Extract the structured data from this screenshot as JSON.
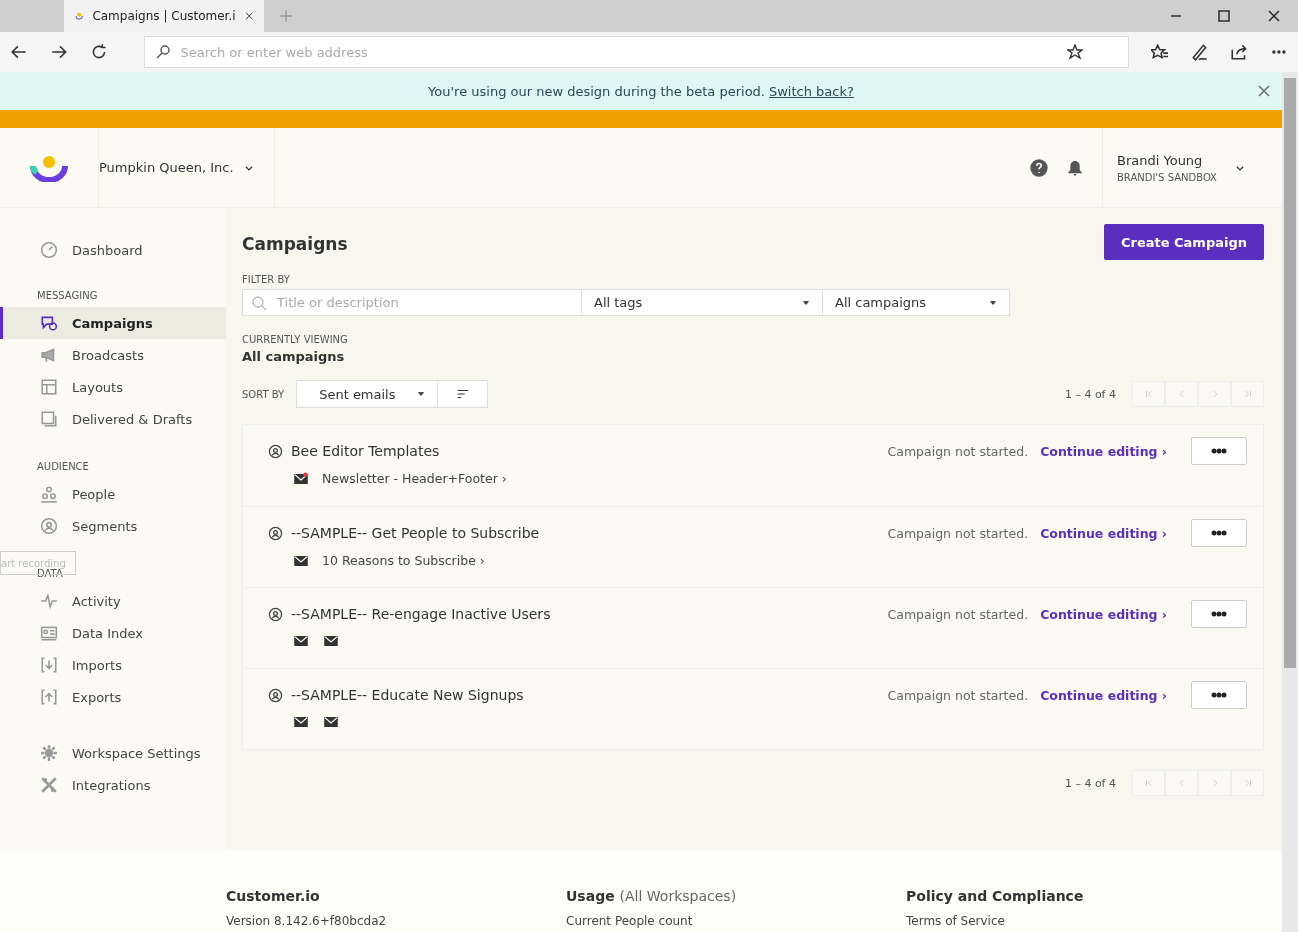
{
  "browser": {
    "tab_title": "Campaigns | Customer.i",
    "address_placeholder": "Search or enter web address"
  },
  "banner": {
    "text": "You're using our new design during the beta period.",
    "link": "Switch back?"
  },
  "header": {
    "workspace": "Pumpkin Queen, Inc.",
    "user_name": "Brandi Young",
    "sandbox": "BRANDI'S SANDBOX"
  },
  "sidebar": {
    "sections": [
      {
        "items": [
          {
            "label": "Dashboard",
            "selected": false
          }
        ]
      },
      {
        "heading": "MESSAGING",
        "items": [
          {
            "label": "Campaigns",
            "selected": true
          },
          {
            "label": "Broadcasts",
            "selected": false
          },
          {
            "label": "Layouts",
            "selected": false
          },
          {
            "label": "Delivered & Drafts",
            "selected": false
          }
        ]
      },
      {
        "heading": "AUDIENCE",
        "items": [
          {
            "label": "People",
            "selected": false
          },
          {
            "label": "Segments",
            "selected": false
          }
        ]
      },
      {
        "heading": "DATA",
        "items": [
          {
            "label": "Activity",
            "selected": false
          },
          {
            "label": "Data Index",
            "selected": false
          },
          {
            "label": "Imports",
            "selected": false
          },
          {
            "label": "Exports",
            "selected": false
          }
        ]
      },
      {
        "items": [
          {
            "label": "Workspace Settings",
            "selected": false
          },
          {
            "label": "Integrations",
            "selected": false
          }
        ]
      }
    ],
    "recording_tooltip": "art recording"
  },
  "main": {
    "title": "Campaigns",
    "create_button": "Create Campaign",
    "filter_label": "FILTER BY",
    "search_placeholder": "Title or description",
    "tags_select": "All tags",
    "campaigns_select": "All campaigns",
    "viewing_label": "CURRENTLY VIEWING",
    "viewing_value": "All campaigns",
    "sort_label": "SORT BY",
    "sort_select": "Sent emails",
    "pagination": "1 – 4 of 4",
    "pagination_bottom": "1 – 4 of 4"
  },
  "campaigns": [
    {
      "name": "Bee Editor Templates",
      "status": "Campaign not started.",
      "action": "Continue editing ›",
      "messages": [
        {
          "kind": "named",
          "label": "Newsletter - Header+Footer ›",
          "alert": true
        }
      ]
    },
    {
      "name": "--SAMPLE-- Get People to Subscribe",
      "status": "Campaign not started.",
      "action": "Continue editing ›",
      "messages": [
        {
          "kind": "named",
          "label": "10 Reasons to Subscribe ›",
          "alert": false
        }
      ]
    },
    {
      "name": "--SAMPLE-- Re-engage Inactive Users",
      "status": "Campaign not started.",
      "action": "Continue editing ›",
      "messages": [
        {
          "kind": "icon",
          "alert": false
        },
        {
          "kind": "icon",
          "alert": false
        }
      ]
    },
    {
      "name": "--SAMPLE-- Educate New Signups",
      "status": "Campaign not started.",
      "action": "Continue editing ›",
      "messages": [
        {
          "kind": "icon",
          "alert": false
        },
        {
          "kind": "icon",
          "alert": false
        }
      ]
    }
  ],
  "footer": [
    {
      "title": "Customer.io",
      "line": "Version 8.142.6+f80bcda2"
    },
    {
      "title": "Usage",
      "note": "(All Workspaces)",
      "line": "Current People count"
    },
    {
      "title": "Policy and Compliance",
      "line": "Terms of Service"
    }
  ]
}
